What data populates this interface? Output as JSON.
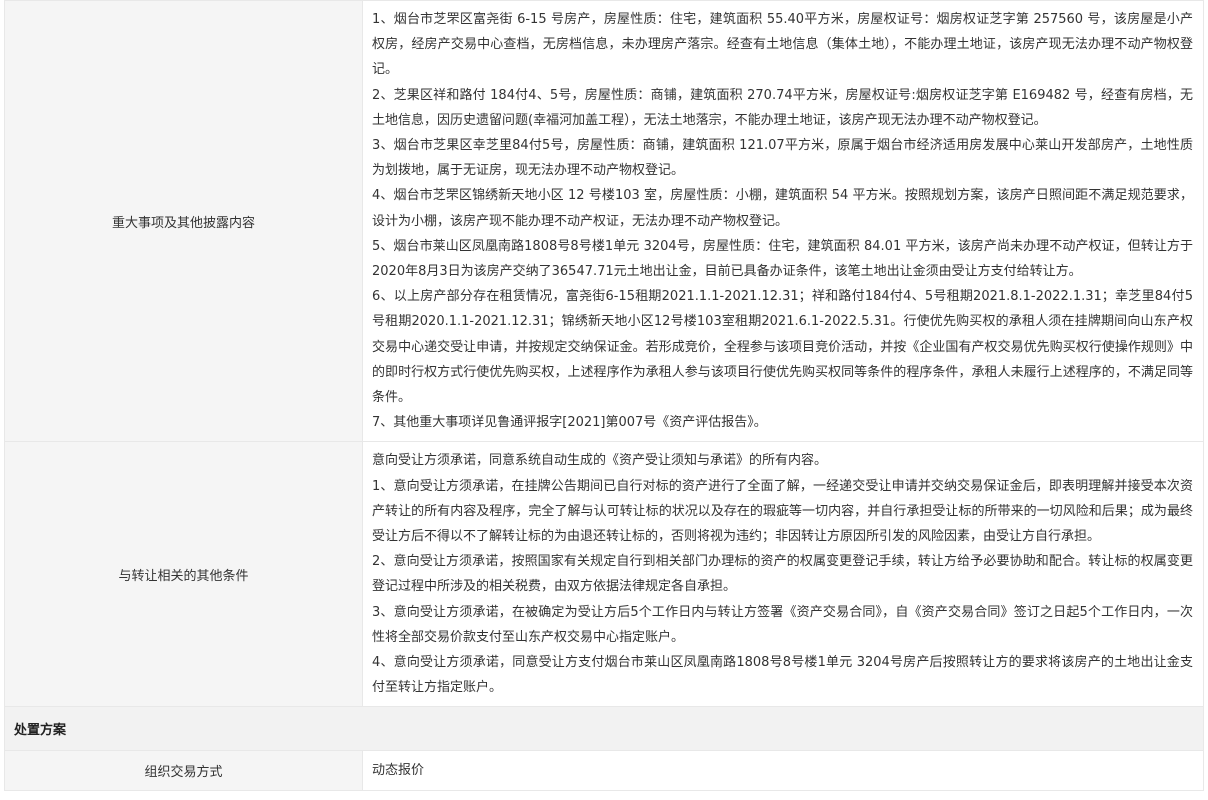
{
  "rows": {
    "major_matters": {
      "label": "重大事项及其他披露内容",
      "paragraphs": [
        "1、烟台市芝罘区富尧街 6-15 号房产，房屋性质：住宅，建筑面积 55.40平方米，房屋权证号：烟房权证芝字第 257560 号，该房屋是小产权房，经房产交易中心查档，无房档信息，未办理房产落宗。经查有土地信息（集体土地），不能办理土地证，该房产现无法办理不动产物权登记。",
        "2、芝果区祥和路付 184付4、5号，房屋性质：商铺，建筑面积 270.74平方米，房屋权证号:烟房权证芝字第 E169482 号，经查有房档，无土地信息，因历史遗留问题(幸福河加盖工程），无法土地落宗，不能办理土地证，该房产现无法办理不动产物权登记。",
        "3、烟台市芝果区幸芝里84付5号，房屋性质：商铺，建筑面积 121.07平方米，原属于烟台市经济适用房发展中心莱山开发部房产，土地性质为划拨地，属于无证房，现无法办理不动产物权登记。",
        "4、烟台市芝罘区锦绣新天地小区 12 号楼103 室，房屋性质：小棚，建筑面积 54 平方米。按照规划方案，该房产日照间距不满足规范要求，设计为小棚，该房产现不能办理不动产权证，无法办理不动产物权登记。",
        "5、烟台市莱山区凤凰南路1808号8号楼1单元 3204号，房屋性质：住宅，建筑面积 84.01 平方米，该房产尚未办理不动产权证，但转让方于2020年8月3日为该房产交纳了36547.71元土地出让金，目前已具备办证条件，该笔土地出让金须由受让方支付给转让方。",
        "6、以上房产部分存在租赁情况，富尧街6-15租期2021.1.1-2021.12.31；祥和路付184付4、5号租期2021.8.1-2022.1.31；幸芝里84付5号租期2020.1.1-2021.12.31；锦绣新天地小区12号楼103室租期2021.6.1-2022.5.31。行使优先购买权的承租人须在挂牌期间向山东产权交易中心递交受让申请，并按规定交纳保证金。若形成竞价，全程参与该项目竞价活动，并按《企业国有产权交易优先购买权行使操作规则》中的即时行权方式行使优先购买权，上述程序作为承租人参与该项目行使优先购买权同等条件的程序条件，承租人未履行上述程序的，不满足同等条件。",
        "7、其他重大事项详见鲁通评报字[2021]第007号《资产评估报告》。"
      ]
    },
    "other_conditions": {
      "label": "与转让相关的其他条件",
      "paragraphs": [
        "意向受让方须承诺，同意系统自动生成的《资产受让须知与承诺》的所有内容。",
        "1、意向受让方须承诺，在挂牌公告期间已自行对标的资产进行了全面了解，一经递交受让申请并交纳交易保证金后，即表明理解并接受本次资产转让的所有内容及程序，完全了解与认可转让标的状况以及存在的瑕疵等一切内容，并自行承担受让标的所带来的一切风险和后果；成为最终受让方后不得以不了解转让标的为由退还转让标的，否则将视为违约；非因转让方原因所引发的风险因素，由受让方自行承担。",
        "2、意向受让方须承诺，按照国家有关规定自行到相关部门办理标的资产的权属变更登记手续，转让方给予必要协助和配合。转让标的权属变更登记过程中所涉及的相关税费，由双方依据法律规定各自承担。",
        "3、意向受让方须承诺，在被确定为受让方后5个工作日内与转让方签署《资产交易合同》，自《资产交易合同》签订之日起5个工作日内，一次性将全部交易价款支付至山东产权交易中心指定账户。",
        "4、意向受让方须承诺，同意受让方支付烟台市莱山区凤凰南路1808号8号楼1单元 3204号房产后按照转让方的要求将该房产的土地出让金支付至转让方指定账户。"
      ]
    }
  },
  "section": {
    "title": "处置方案"
  },
  "trade_method": {
    "label": "组织交易方式",
    "value": "动态报价"
  }
}
